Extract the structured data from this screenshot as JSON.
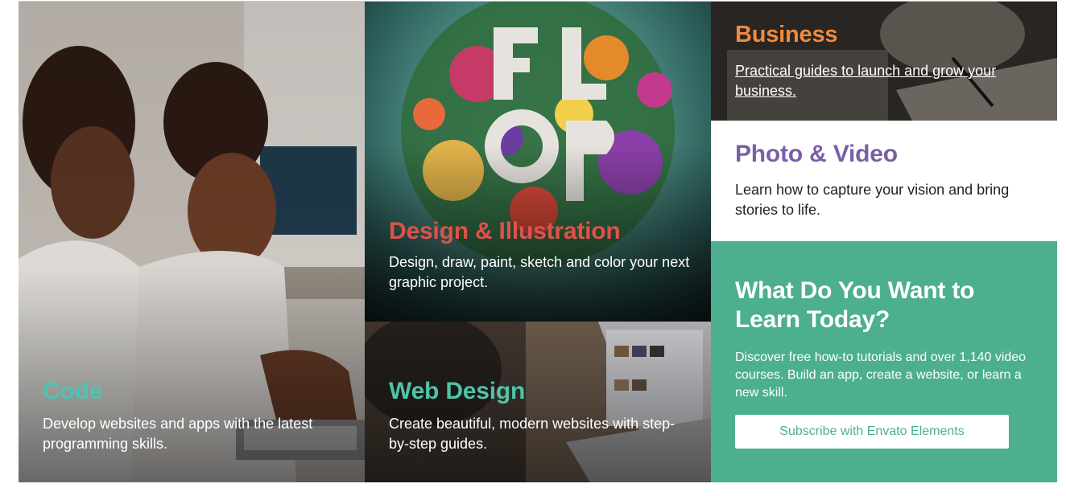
{
  "tiles": {
    "code": {
      "title": "Code",
      "description": "Develop websites and apps with the latest programming skills.",
      "title_color": "#4fc3b3"
    },
    "design": {
      "title": "Design & Illustration",
      "description": "Design, draw, paint, sketch and color your next graphic project.",
      "title_color": "#e0514b"
    },
    "web_design": {
      "title": "Web Design",
      "description": "Create beautiful, modern websites with step-by-step guides.",
      "title_color": "#4fc3a8"
    },
    "business": {
      "title": "Business",
      "description": "Practical guides to launch and grow your business.",
      "title_color": "#f08a3e"
    },
    "photo_video": {
      "title": "Photo & Video",
      "description": "Learn how to capture your vision and bring stories to life.",
      "title_color": "#7b5ea7"
    },
    "learn": {
      "title": "What Do You Want to Learn Today?",
      "description": "Discover free how-to tutorials and over 1,140 video courses. Build an app, create a website, or learn a new skill.",
      "button_label": "Subscribe with Envato Elements",
      "background_color": "#4caf8f"
    }
  }
}
